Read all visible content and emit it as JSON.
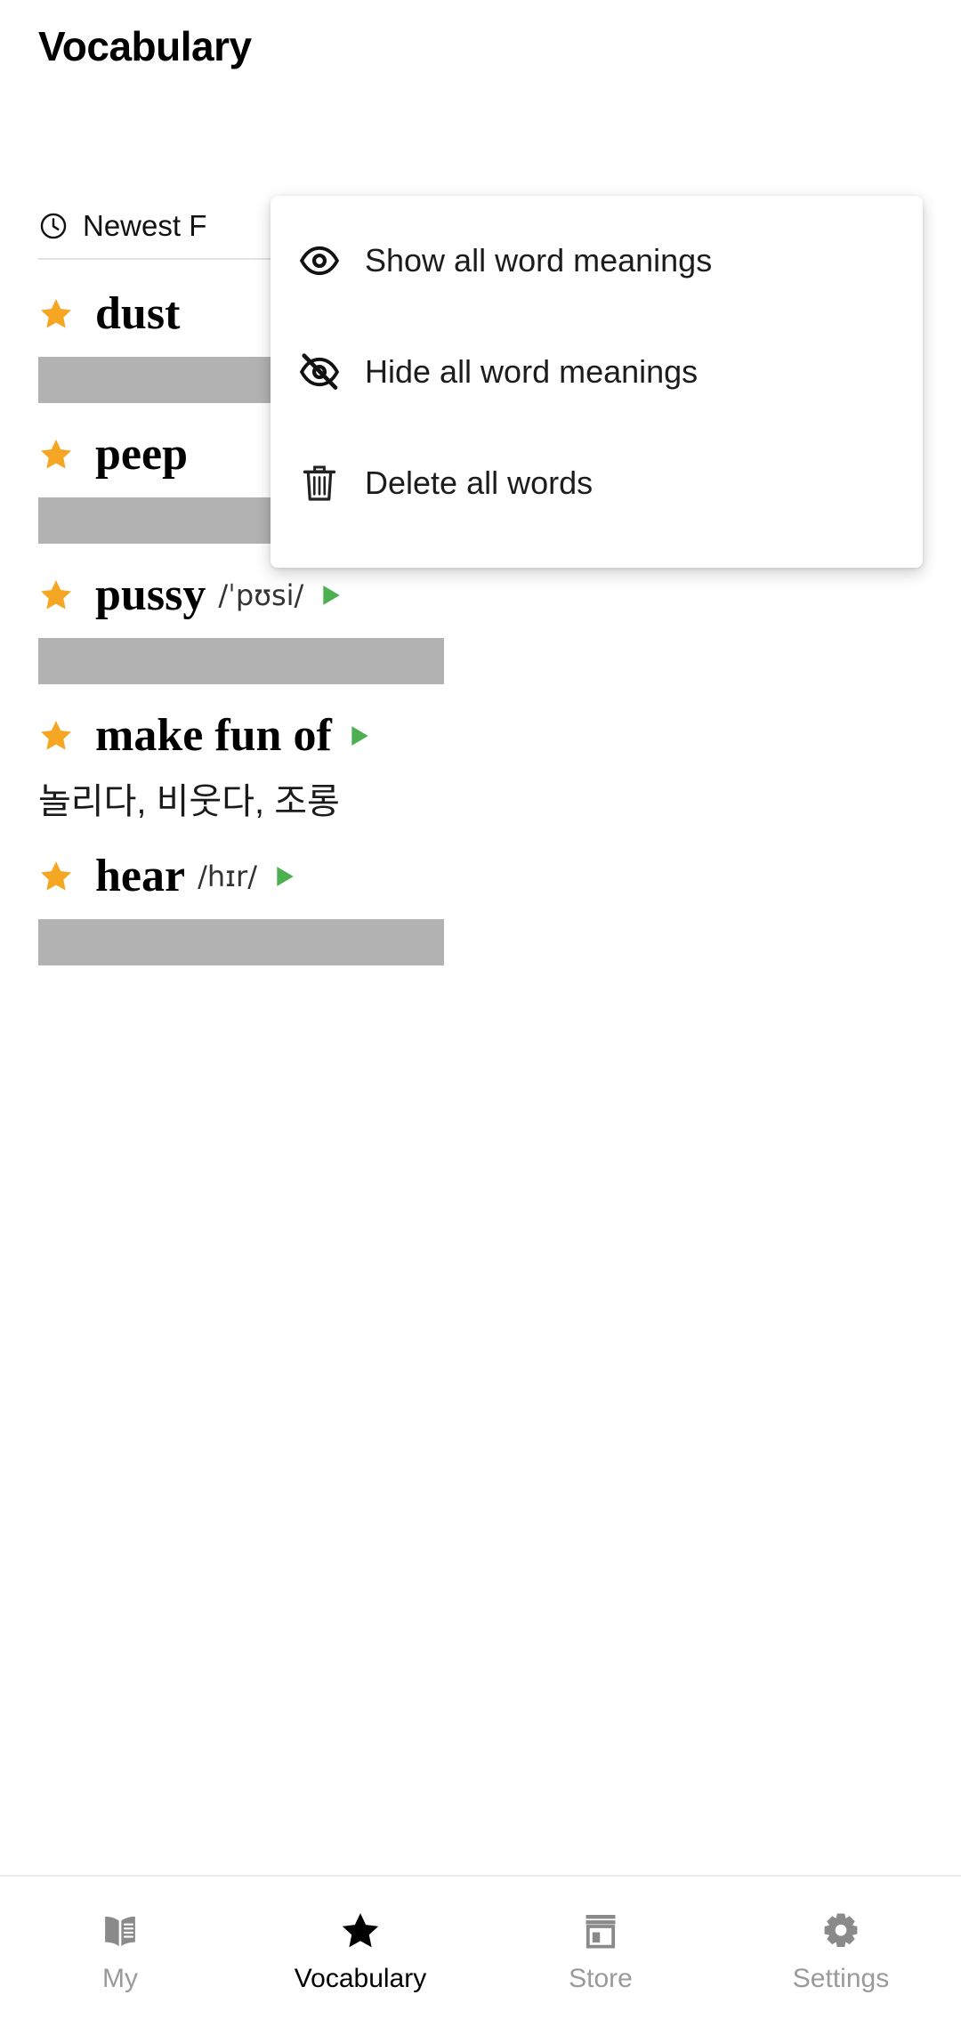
{
  "header": {
    "title": "Vocabulary"
  },
  "sort": {
    "icon": "clock-icon",
    "label": "Newest F"
  },
  "colors": {
    "star": "#f5a623",
    "play": "#4caf50",
    "hidden_bar": "#b2b2b2",
    "muted_text": "#9a9a9a",
    "active_text": "#000000"
  },
  "words": [
    {
      "starred": true,
      "term": "dust",
      "phonetic": "",
      "has_audio": false,
      "meaning_hidden": true,
      "meaning": ""
    },
    {
      "starred": true,
      "term": "peep",
      "phonetic": "",
      "has_audio": false,
      "meaning_hidden": true,
      "meaning": ""
    },
    {
      "starred": true,
      "term": "pussy",
      "phonetic": "/ˈpʊsi/",
      "has_audio": true,
      "meaning_hidden": true,
      "meaning": ""
    },
    {
      "starred": true,
      "term": "make fun of",
      "phonetic": "",
      "has_audio": true,
      "meaning_hidden": false,
      "meaning": "놀리다, 비웃다, 조롱"
    },
    {
      "starred": true,
      "term": "hear",
      "phonetic": "/hɪr/",
      "has_audio": true,
      "meaning_hidden": true,
      "meaning": ""
    }
  ],
  "overflow_menu": {
    "items": [
      {
        "icon": "eye-icon",
        "label": "Show all word meanings"
      },
      {
        "icon": "eye-off-icon",
        "label": "Hide all word meanings"
      },
      {
        "icon": "trash-icon",
        "label": "Delete all words"
      }
    ]
  },
  "bottom_nav": {
    "items": [
      {
        "icon": "book-icon",
        "label": "My",
        "active": false
      },
      {
        "icon": "star-icon",
        "label": "Vocabulary",
        "active": true
      },
      {
        "icon": "store-icon",
        "label": "Store",
        "active": false
      },
      {
        "icon": "gear-icon",
        "label": "Settings",
        "active": false
      }
    ]
  }
}
